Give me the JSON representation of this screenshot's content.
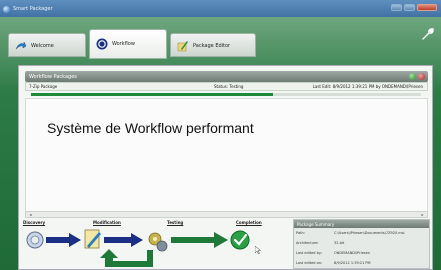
{
  "window": {
    "title": "Smart Packager"
  },
  "tabs": [
    {
      "label": "Welcome",
      "icon": "welcome-arrow-icon"
    },
    {
      "label": "Workflow",
      "icon": "workflow-circle-icon",
      "active": true
    },
    {
      "label": "Package Editor",
      "icon": "package-editor-icon"
    }
  ],
  "workflow_packages": {
    "title": "Workflow Packages",
    "row": {
      "name": "7-Zip Package",
      "status": "Status: Testing",
      "last_edit": "Last Edit: 8/9/2012 1:39:21 PM by ONDEMAND\\lPriesen"
    },
    "progress": 0.62
  },
  "caption": "Système de Workflow performant",
  "workflow_steps": [
    "Discovery",
    "Modification",
    "Testing",
    "Completion"
  ],
  "summary": {
    "title": "Package Summary",
    "rows": [
      {
        "key": "Path:",
        "value": "C:\\Users\\lPriesen\\Documents\\7Z920.msi"
      },
      {
        "key": "Architecture:",
        "value": "32-bit"
      },
      {
        "key": "Last edited by:",
        "value": "ONDEMAND\\lPriesen"
      },
      {
        "key": "Last edited on:",
        "value": "8/9/2012 1:39:21 PM"
      }
    ]
  },
  "colors": {
    "accent_green": "#1c8a3b",
    "arrow_blue": "#1b2f86"
  }
}
